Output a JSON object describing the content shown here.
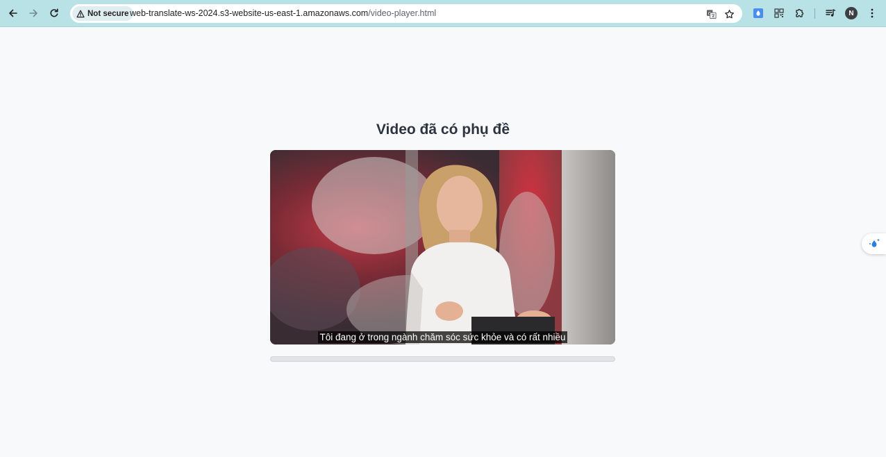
{
  "browser": {
    "security_label": "Not secure",
    "url_host": "web-translate-ws-2024.s3-website-us-east-1.amazonaws.com",
    "url_path": "/video-player.html",
    "profile_initial": "N",
    "icons": {
      "back": "arrow-left-icon",
      "forward": "arrow-right-icon",
      "reload": "reload-icon",
      "security": "warning-triangle-icon",
      "translate": "translate-icon",
      "bookmark": "star-icon",
      "extension_1": "water-drop-icon",
      "extension_2": "qr-code-icon",
      "extensions_menu": "puzzle-icon",
      "media": "media-control-icon",
      "menu": "kebab-menu-icon"
    }
  },
  "page": {
    "title": "Video đã có phụ đề",
    "video": {
      "subtitle": "Tôi đang ở trong ngành chăm sóc sức khỏe và có rất nhiều"
    },
    "progress": {
      "fraction": 0
    },
    "side_widget_icon": "sparkle-drop-icon"
  },
  "colors": {
    "toolbar_bg": "#b8e2e6",
    "page_bg": "#f8f9fb",
    "title_text": "#2d3440"
  }
}
